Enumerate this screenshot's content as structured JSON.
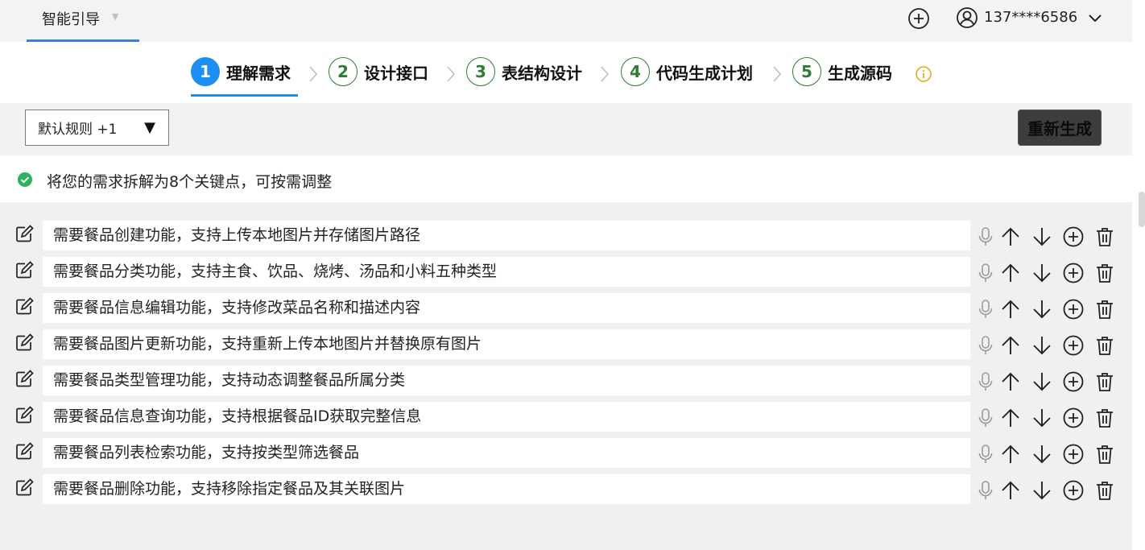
{
  "topbar": {
    "tab_label": "智能引导",
    "user_phone": "137****6586"
  },
  "steps": [
    {
      "num": "1",
      "label": "理解需求",
      "active": true
    },
    {
      "num": "2",
      "label": "设计接口",
      "active": false
    },
    {
      "num": "3",
      "label": "表结构设计",
      "active": false
    },
    {
      "num": "4",
      "label": "代码生成计划",
      "active": false
    },
    {
      "num": "5",
      "label": "生成源码",
      "active": false
    }
  ],
  "rules": {
    "select_value": "默认规则 +1",
    "regenerate_label": "重新生成"
  },
  "status": {
    "text": "将您的需求拆解为8个关键点，可按需调整"
  },
  "requirements": [
    "需要餐品创建功能，支持上传本地图片并存储图片路径",
    "需要餐品分类功能，支持主食、饮品、烧烤、汤品和小料五种类型",
    "需要餐品信息编辑功能，支持修改菜品名称和描述内容",
    "需要餐品图片更新功能，支持重新上传本地图片并替换原有图片",
    "需要餐品类型管理功能，支持动态调整餐品所属分类",
    "需要餐品信息查询功能，支持根据餐品ID获取完整信息",
    "需要餐品列表检索功能，支持按类型筛选餐品",
    "需要餐品删除功能，支持移除指定餐品及其关联图片"
  ],
  "colors": {
    "accent": "#1e8ff2",
    "step_border": "#2e7d32",
    "success": "#2db35d",
    "info": "#e6a817",
    "regen_bg": "#3d3d3d"
  },
  "icons": {
    "edit": "edit-icon",
    "mic": "microphone-icon",
    "up": "arrow-up-icon",
    "down": "arrow-down-icon",
    "add": "plus-circle-icon",
    "delete": "trash-icon"
  }
}
